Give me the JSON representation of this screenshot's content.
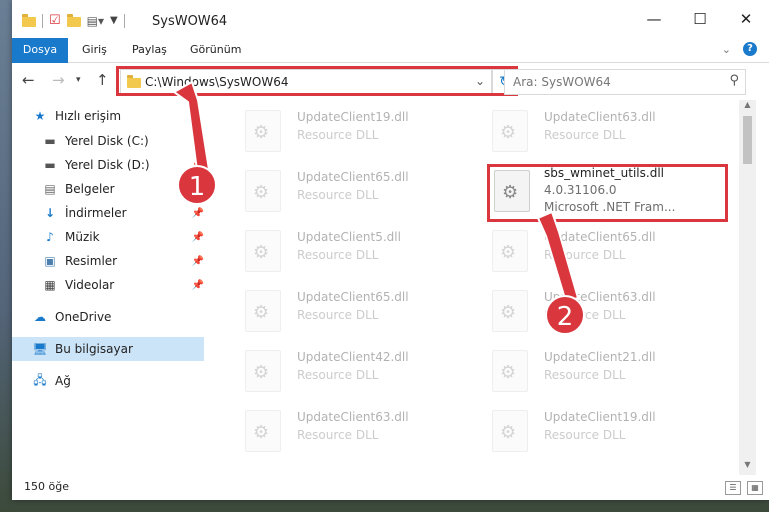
{
  "window": {
    "title": "SysWOW64",
    "controls": {
      "minimize": "—",
      "maximize": "☐",
      "close": "✕"
    }
  },
  "ribbon": {
    "tabs": [
      {
        "label": "Dosya"
      },
      {
        "label": "Giriş"
      },
      {
        "label": "Paylaş"
      },
      {
        "label": "Görünüm"
      }
    ]
  },
  "nav": {
    "address": "C:\\Windows\\SysWOW64",
    "search_placeholder": "Ara: SysWOW64"
  },
  "sidebar": {
    "items": [
      {
        "label": "Hızlı erişim",
        "icon": "star-icon"
      },
      {
        "label": "Yerel Disk (C:)",
        "icon": "drive-icon",
        "pinned": true
      },
      {
        "label": "Yerel Disk (D:)",
        "icon": "drive-icon",
        "pinned": true
      },
      {
        "label": "Belgeler",
        "icon": "documents-icon",
        "pinned": true
      },
      {
        "label": "İndirmeler",
        "icon": "download-icon",
        "pinned": true
      },
      {
        "label": "Müzik",
        "icon": "music-icon",
        "pinned": true
      },
      {
        "label": "Resimler",
        "icon": "pictures-icon",
        "pinned": true
      },
      {
        "label": "Videolar",
        "icon": "videos-icon",
        "pinned": true
      },
      {
        "label": "OneDrive",
        "icon": "cloud-icon"
      },
      {
        "label": "Bu bilgisayar",
        "icon": "computer-icon",
        "selected": true
      },
      {
        "label": "Ağ",
        "icon": "network-icon"
      }
    ]
  },
  "files": [
    {
      "name": "UpdateClient19.dll",
      "type": "Resource DLL"
    },
    {
      "name": "UpdateClient63.dll",
      "type": "Resource DLL"
    },
    {
      "name": "UpdateClient65.dll",
      "type": "Resource DLL"
    },
    {
      "name": "sbs_wminet_utils.dll",
      "version": "4.0.31106.0",
      "company": "Microsoft .NET Fram..."
    },
    {
      "name": "UpdateClient5.dll",
      "type": "Resource DLL"
    },
    {
      "name": "UpdateClient65.dll",
      "type": "Resource DLL"
    },
    {
      "name": "UpdateClient65.dll",
      "type": "Resource DLL"
    },
    {
      "name": "UpdateClient63.dll",
      "type": "Resource DLL"
    },
    {
      "name": "UpdateClient42.dll",
      "type": "Resource DLL"
    },
    {
      "name": "UpdateClient21.dll",
      "type": "Resource DLL"
    },
    {
      "name": "UpdateClient63.dll",
      "type": "Resource DLL"
    },
    {
      "name": "UpdateClient19.dll",
      "type": "Resource DLL"
    }
  ],
  "status": {
    "count": "150 öğe"
  },
  "annotations": {
    "step1": "1",
    "step2": "2",
    "color": "#d9363e"
  },
  "colors": {
    "accent": "#1979ca",
    "selected": "#cce4f7",
    "folder": "#f2c94c"
  }
}
